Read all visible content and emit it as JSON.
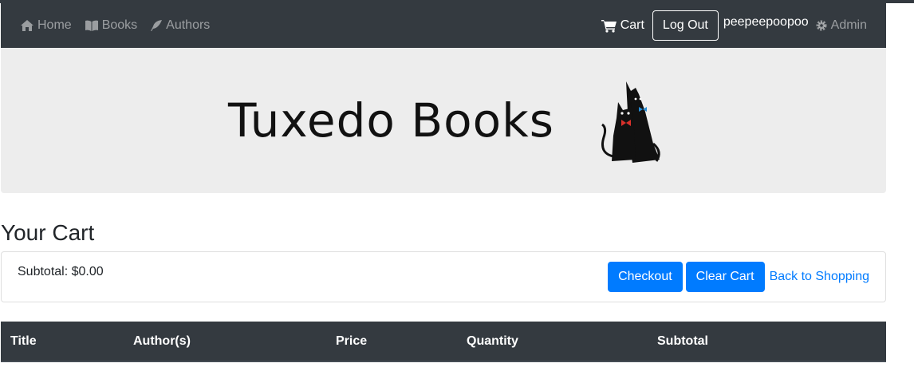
{
  "nav": {
    "home_label": "Home",
    "books_label": "Books",
    "authors_label": "Authors",
    "cart_label": "Cart",
    "logout_label": "Log Out",
    "username": "peepeepoopoo",
    "admin_label": "Admin"
  },
  "banner": {
    "logo_text": "Tuxedo Books"
  },
  "page": {
    "title": "Your Cart"
  },
  "cart": {
    "subtotal_text": "Subtotal: $0.00",
    "checkout_label": "Checkout",
    "clear_label": "Clear Cart",
    "back_label": "Back to Shopping"
  },
  "table": {
    "columns": [
      "Title",
      "Author(s)",
      "Price",
      "Quantity",
      "Subtotal"
    ]
  },
  "colors": {
    "navbar": "#343a40",
    "primary": "#007bff",
    "banner": "#ededed"
  },
  "icons": [
    "home-icon",
    "book-icon",
    "feather-icon",
    "cart-icon",
    "gear-icon",
    "cat-logo-icon"
  ]
}
